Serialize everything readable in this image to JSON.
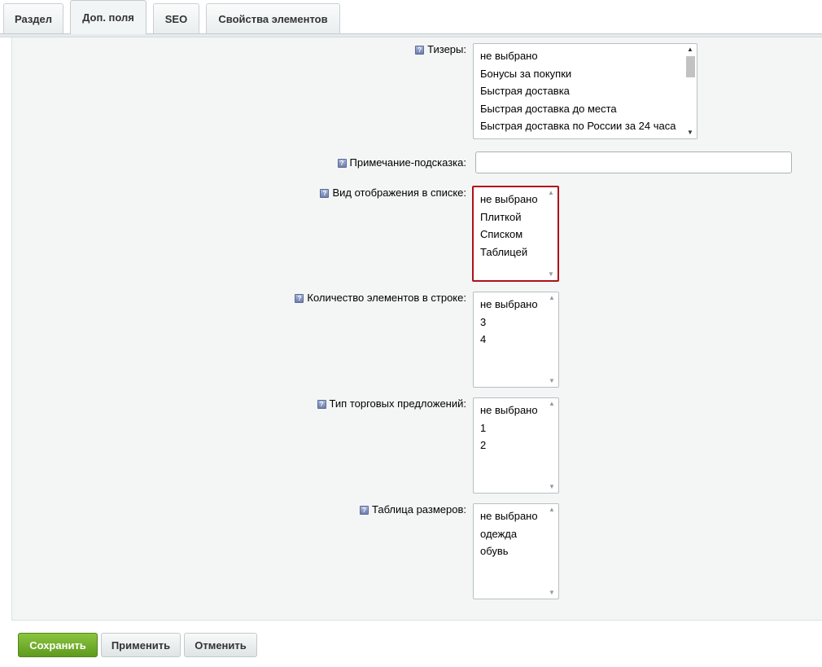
{
  "tabs": [
    {
      "label": "Раздел"
    },
    {
      "label": "Доп. поля"
    },
    {
      "label": "SEO"
    },
    {
      "label": "Свойства элементов"
    }
  ],
  "fields": {
    "teasers": {
      "label": "Тизеры:",
      "options": [
        "не выбрано",
        "Бонусы за покупки",
        "Быстрая доставка",
        "Быстрая доставка до места",
        "Быстрая доставка по России за 24 часа"
      ]
    },
    "hint": {
      "label": "Примечание-подсказка:",
      "value": ""
    },
    "view_mode": {
      "label": "Вид отображения в списке:",
      "options": [
        "не выбрано",
        "Плиткой",
        "Списком",
        "Таблицей"
      ]
    },
    "items_per_row": {
      "label": "Количество элементов в строке:",
      "options": [
        "не выбрано",
        "3",
        "4"
      ]
    },
    "offer_type": {
      "label": "Тип торговых предложений:",
      "options": [
        "не выбрано",
        "1",
        "2"
      ]
    },
    "size_table": {
      "label": "Таблица размеров:",
      "options": [
        "не выбрано",
        "одежда",
        "обувь"
      ]
    }
  },
  "buttons": {
    "save": "Сохранить",
    "apply": "Применить",
    "cancel": "Отменить"
  },
  "colors": {
    "save_button": "#6ea62a",
    "active_field_border": "#b00f1b"
  }
}
